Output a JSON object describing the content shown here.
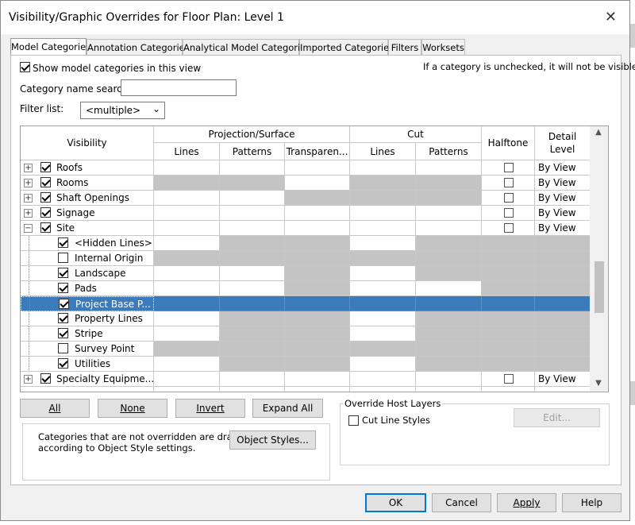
{
  "window": {
    "title": "Visibility/Graphic Overrides for Floor Plan: Level 1",
    "close_icon": "✕"
  },
  "tabs": [
    {
      "label": "Model Categories",
      "active": true
    },
    {
      "label": "Annotation Categories"
    },
    {
      "label": "Analytical Model Categories"
    },
    {
      "label": "Imported Categories"
    },
    {
      "label": "Filters"
    },
    {
      "label": "Worksets"
    }
  ],
  "show_categories": {
    "label": "Show model categories in this view",
    "checked": true
  },
  "hint": "If a category is unchecked, it will not be visible.",
  "search": {
    "label": "Category name search:",
    "value": ""
  },
  "filter": {
    "label": "Filter list:",
    "value": "<multiple>"
  },
  "table": {
    "headers": {
      "visibility": "Visibility",
      "projection": "Projection/Surface",
      "cut": "Cut",
      "halftone": "Halftone",
      "detail_level_1": "Detail",
      "detail_level_2": "Level",
      "lines": "Lines",
      "patterns": "Patterns",
      "transparency": "Transparen...",
      "cut_lines": "Lines",
      "cut_patterns": "Patterns"
    },
    "rows": [
      {
        "name": "Roofs",
        "level": 0,
        "expander": "+",
        "checked": true,
        "detail": "By View",
        "gray": []
      },
      {
        "name": "Rooms",
        "level": 0,
        "expander": "+",
        "checked": true,
        "detail": "By View",
        "gray": [
          0,
          1,
          3,
          4
        ]
      },
      {
        "name": "Shaft Openings",
        "level": 0,
        "expander": "+",
        "checked": true,
        "detail": "By View",
        "gray": [
          2,
          3,
          4
        ]
      },
      {
        "name": "Signage",
        "level": 0,
        "expander": "+",
        "checked": true,
        "detail": "By View",
        "gray": []
      },
      {
        "name": "Site",
        "level": 0,
        "expander": "−",
        "checked": true,
        "detail": "By View",
        "gray": []
      },
      {
        "name": "<Hidden Lines>",
        "level": 1,
        "checked": true,
        "detail": "",
        "gray": [
          1,
          2,
          4,
          5,
          6
        ]
      },
      {
        "name": "Internal Origin",
        "level": 1,
        "checked": false,
        "detail": "",
        "gray": [
          0,
          1,
          2,
          3,
          4,
          5,
          6
        ]
      },
      {
        "name": "Landscape",
        "level": 1,
        "checked": true,
        "detail": "",
        "gray": [
          2,
          4,
          5,
          6
        ]
      },
      {
        "name": "Pads",
        "level": 1,
        "checked": true,
        "detail": "",
        "gray": [
          2,
          5,
          6
        ]
      },
      {
        "name": "Project Base P...",
        "level": 1,
        "checked": true,
        "detail": "",
        "gray": [],
        "selected": true
      },
      {
        "name": "Property Lines",
        "level": 1,
        "checked": true,
        "detail": "",
        "gray": [
          1,
          2,
          4,
          5,
          6
        ]
      },
      {
        "name": "Stripe",
        "level": 1,
        "checked": true,
        "detail": "",
        "gray": [
          1,
          2,
          4,
          5,
          6
        ]
      },
      {
        "name": "Survey Point",
        "level": 1,
        "checked": false,
        "detail": "",
        "gray": [
          0,
          1,
          2,
          3,
          4,
          5,
          6
        ]
      },
      {
        "name": "Utilities",
        "level": 1,
        "checked": true,
        "detail": "",
        "gray": [
          1,
          2,
          4,
          5,
          6
        ]
      },
      {
        "name": "Specialty Equipme...",
        "level": 0,
        "expander": "+",
        "checked": true,
        "detail": "By View",
        "gray": []
      }
    ]
  },
  "buttons": {
    "all": "All",
    "none": "None",
    "invert": "Invert",
    "expand_all": "Expand All",
    "object_styles": "Object Styles...",
    "edit": "Edit...",
    "ok": "OK",
    "cancel": "Cancel",
    "apply": "Apply",
    "help": "Help"
  },
  "note": {
    "line1": "Categories that are not overridden are drawn",
    "line2": "according to Object Style settings."
  },
  "override_host": {
    "title": "Override Host Layers",
    "cut_line_styles": "Cut Line Styles"
  }
}
